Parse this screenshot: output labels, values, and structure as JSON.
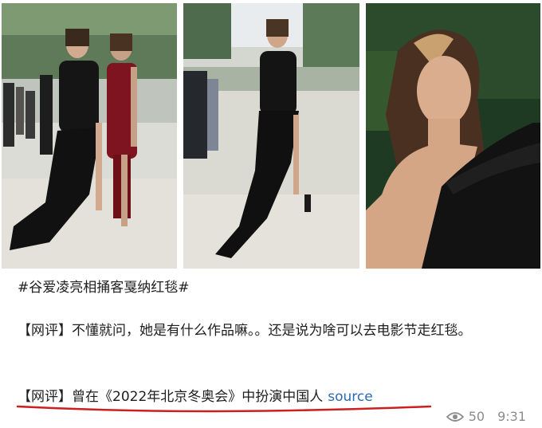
{
  "post": {
    "hashtag": "#谷爱凌亮相捅客戛纳红毯#",
    "comment1": "【网评】不懂就问，她是有什么作品嘛。。还是说为啥可以去电影节走红毯。",
    "comment2": "【网评】曾在《2022年北京冬奥会》中扮演中国人",
    "source_label": "source"
  },
  "meta": {
    "views": "50",
    "time": "9:31",
    "icon": "eye-icon"
  },
  "colors": {
    "link": "#2b6ab3",
    "underline": "#cc1f1f",
    "meta": "#8c8c8c"
  }
}
